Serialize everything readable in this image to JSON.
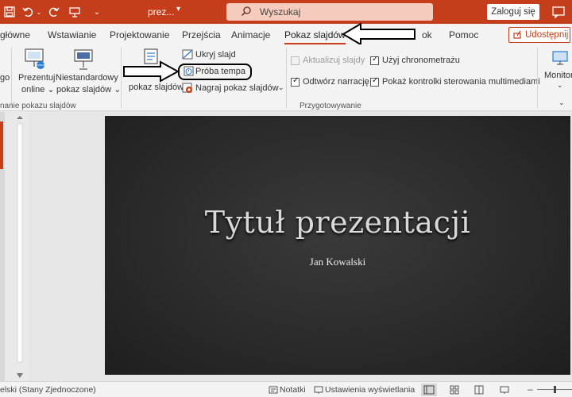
{
  "titlebar": {
    "filename": "prez...",
    "search_placeholder": "Wyszukaj",
    "login_label": "Zaloguj się"
  },
  "tabs": [
    {
      "label": "główne"
    },
    {
      "label": "Wstawianie"
    },
    {
      "label": "Projektowanie"
    },
    {
      "label": "Przejścia"
    },
    {
      "label": "Animacje"
    },
    {
      "label": "Pokaz slajdów",
      "active": true
    },
    {
      "label": "ok"
    },
    {
      "label": "Pomoc"
    }
  ],
  "share_label": "Udostępnij",
  "ribbon": {
    "partial_left_label": "go",
    "present_online": [
      "Prezentuj",
      "online ⌄"
    ],
    "custom_show": [
      "Niestandardowy",
      "pokaz slajdów ⌄"
    ],
    "group_start_label": "nanie pokazu slajdów",
    "setup_show_label": "pokaz slajdów",
    "hide_slide_label": "Ukryj slajd",
    "rehearse_label": "Próba tempa",
    "record_label": "Nagraj pokaz slajdów",
    "update_slides_label": "Aktualizuj slajdy",
    "use_timings_label": "Użyj chronometrażu",
    "play_narrations_label": "Odtwórz narrację",
    "show_controls_label": "Pokaż kontrolki sterowania multimediami",
    "group_setup_label": "Przygotowywanie",
    "monitor_label": "Monitor",
    "use_timings_checked": true,
    "play_narrations_checked": true,
    "show_controls_checked": true,
    "update_slides_checked": false
  },
  "slide": {
    "title": "Tytuł prezentacji",
    "subtitle": "Jan Kowalski"
  },
  "status": {
    "language": "elski (Stany Zjednoczone)",
    "notes_label": "Notatki",
    "view_settings_label": "Ustawienia wyświetlania"
  },
  "colors": {
    "accent": "#c43e1c",
    "slide_bg": "#2b2b2b"
  }
}
